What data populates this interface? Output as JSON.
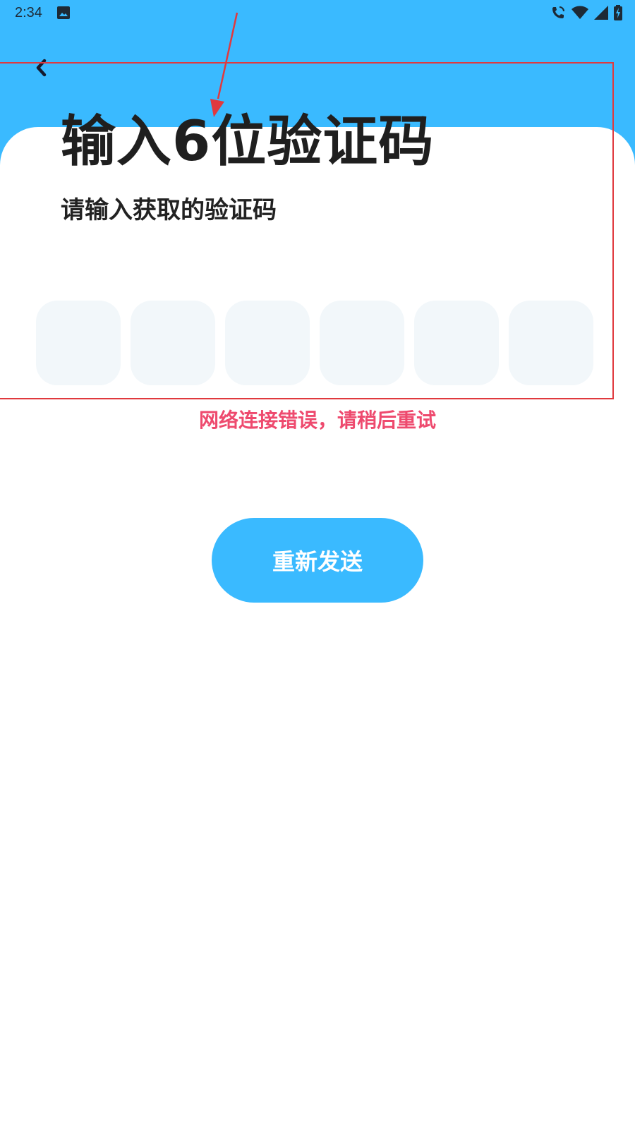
{
  "status_bar": {
    "time": "2:34",
    "icons": [
      "image-icon",
      "call-icon",
      "wifi-icon",
      "signal-icon",
      "battery-charging-icon"
    ]
  },
  "header": {
    "back_icon": "chevron-left-icon"
  },
  "main": {
    "title": "输入6位验证码",
    "subtitle": "请输入获取的验证码",
    "code_inputs": [
      "",
      "",
      "",
      "",
      "",
      ""
    ],
    "error_message": "网络连接错误，请稍后重试",
    "resend_label": "重新发送"
  },
  "colors": {
    "accent": "#3abaff",
    "error": "#ee4a6e",
    "input_bg": "#f2f7fa",
    "annotation": "#e0393e"
  }
}
